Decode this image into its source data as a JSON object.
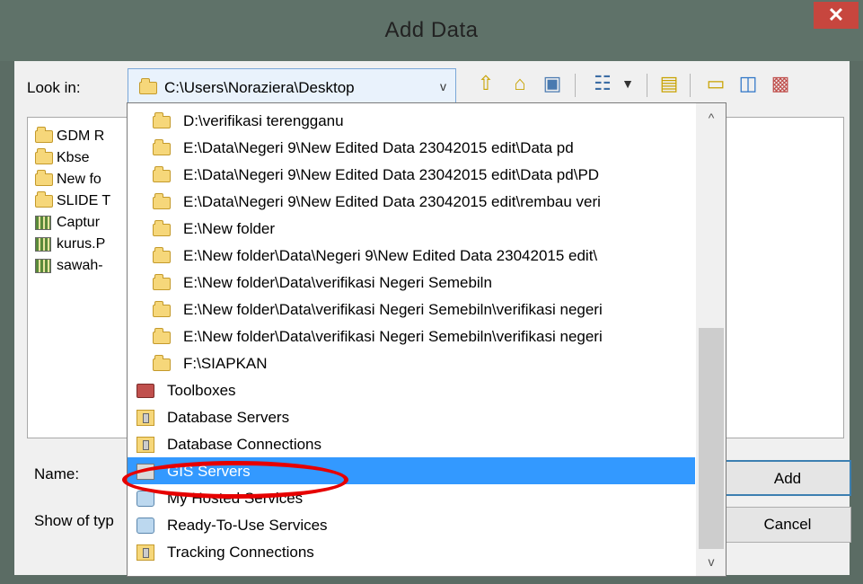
{
  "window": {
    "title": "Add Data",
    "close_glyph": "✕"
  },
  "lookin": {
    "label": "Look in:",
    "value": "C:\\Users\\Noraziera\\Desktop",
    "arrow": "v"
  },
  "toolbar": {
    "icons": [
      "up-one-level-icon",
      "home-icon",
      "connect-folder-icon",
      "view-list-icon",
      "view-dropdown-icon",
      "new-folder-icon",
      "folder-icon",
      "new-shapefile-icon",
      "toolbox-icon"
    ]
  },
  "files": [
    {
      "label": "GDM R",
      "kind": "folder"
    },
    {
      "label": "Kbse",
      "kind": "folder"
    },
    {
      "label": "New fo",
      "kind": "folder"
    },
    {
      "label": "SLIDE T",
      "kind": "folder"
    },
    {
      "label": "Captur",
      "kind": "raster"
    },
    {
      "label": "kurus.P",
      "kind": "raster"
    },
    {
      "label": "sawah-",
      "kind": "raster"
    }
  ],
  "form": {
    "name_label": "Name:",
    "show_label": "Show of typ",
    "add_label": "Add",
    "cancel_label": "Cancel"
  },
  "dropdown": {
    "items": [
      {
        "label": "D:\\verifikasi terengganu",
        "kind": "folder"
      },
      {
        "label": "E:\\Data\\Negeri 9\\New Edited Data 23042015 edit\\Data pd",
        "kind": "folder"
      },
      {
        "label": "E:\\Data\\Negeri 9\\New Edited Data 23042015 edit\\Data pd\\PD",
        "kind": "folder"
      },
      {
        "label": "E:\\Data\\Negeri 9\\New Edited Data 23042015 edit\\rembau veri",
        "kind": "folder"
      },
      {
        "label": "E:\\New folder",
        "kind": "folder"
      },
      {
        "label": "E:\\New folder\\Data\\Negeri 9\\New Edited Data 23042015 edit\\",
        "kind": "folder"
      },
      {
        "label": "E:\\New folder\\Data\\verifikasi Negeri Semebiln",
        "kind": "folder"
      },
      {
        "label": "E:\\New folder\\Data\\verifikasi Negeri Semebiln\\verifikasi negeri",
        "kind": "folder"
      },
      {
        "label": "E:\\New folder\\Data\\verifikasi Negeri Semebiln\\verifikasi negeri",
        "kind": "folder"
      },
      {
        "label": "F:\\SIAPKAN",
        "kind": "folder"
      },
      {
        "label": "Toolboxes",
        "kind": "toolbox"
      },
      {
        "label": "Database Servers",
        "kind": "db"
      },
      {
        "label": "Database Connections",
        "kind": "db"
      },
      {
        "label": "GIS Servers",
        "kind": "gis",
        "selected": true
      },
      {
        "label": "My Hosted Services",
        "kind": "svc"
      },
      {
        "label": "Ready-To-Use Services",
        "kind": "svc"
      },
      {
        "label": "Tracking Connections",
        "kind": "db"
      }
    ]
  },
  "scroll": {
    "up_glyph": "^",
    "down_glyph": "v"
  }
}
